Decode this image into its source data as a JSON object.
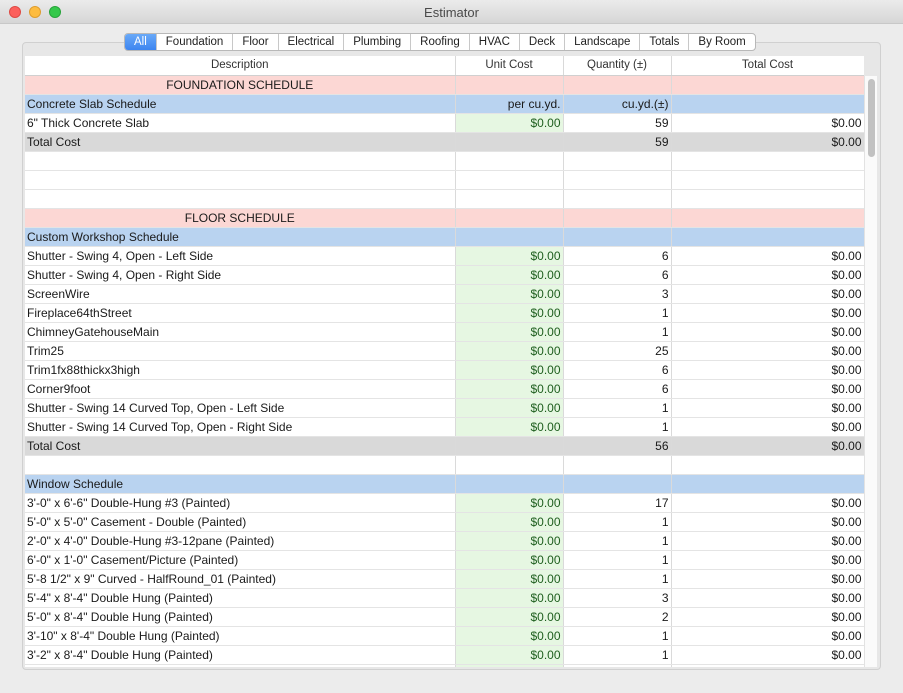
{
  "window": {
    "title": "Estimator"
  },
  "tabs": [
    {
      "label": "All",
      "active": true
    },
    {
      "label": "Foundation",
      "active": false
    },
    {
      "label": "Floor",
      "active": false
    },
    {
      "label": "Electrical",
      "active": false
    },
    {
      "label": "Plumbing",
      "active": false
    },
    {
      "label": "Roofing",
      "active": false
    },
    {
      "label": "HVAC",
      "active": false
    },
    {
      "label": "Deck",
      "active": false
    },
    {
      "label": "Landscape",
      "active": false
    },
    {
      "label": "Totals",
      "active": false
    },
    {
      "label": "By Room",
      "active": false
    }
  ],
  "columns": [
    "Description",
    "Unit Cost",
    "Quantity (±)",
    "Total Cost"
  ],
  "rows": [
    {
      "type": "sched",
      "desc": "FOUNDATION SCHEDULE",
      "unit": "",
      "qty": "",
      "total": ""
    },
    {
      "type": "sub",
      "desc": "Concrete Slab Schedule",
      "unit": "per cu.yd.",
      "qty": "cu.yd.(±)",
      "total": ""
    },
    {
      "type": "item",
      "desc": "6\" Thick Concrete Slab",
      "unit": "$0.00",
      "qty": "59",
      "total": "$0.00"
    },
    {
      "type": "total",
      "desc": "Total Cost",
      "unit": "",
      "qty": "59",
      "total": "$0.00"
    },
    {
      "type": "blank",
      "desc": "",
      "unit": "",
      "qty": "",
      "total": ""
    },
    {
      "type": "blank",
      "desc": "",
      "unit": "",
      "qty": "",
      "total": ""
    },
    {
      "type": "blank",
      "desc": "",
      "unit": "",
      "qty": "",
      "total": ""
    },
    {
      "type": "sched",
      "desc": "FLOOR SCHEDULE",
      "unit": "",
      "qty": "",
      "total": ""
    },
    {
      "type": "sub",
      "desc": "Custom Workshop Schedule",
      "unit": "",
      "qty": "",
      "total": ""
    },
    {
      "type": "item",
      "desc": "Shutter - Swing 4, Open - Left Side",
      "unit": "$0.00",
      "qty": "6",
      "total": "$0.00"
    },
    {
      "type": "item",
      "desc": "Shutter - Swing 4, Open - Right Side",
      "unit": "$0.00",
      "qty": "6",
      "total": "$0.00"
    },
    {
      "type": "item",
      "desc": "ScreenWire",
      "unit": "$0.00",
      "qty": "3",
      "total": "$0.00"
    },
    {
      "type": "item",
      "desc": "Fireplace64thStreet",
      "unit": "$0.00",
      "qty": "1",
      "total": "$0.00"
    },
    {
      "type": "item",
      "desc": "ChimneyGatehouseMain",
      "unit": "$0.00",
      "qty": "1",
      "total": "$0.00"
    },
    {
      "type": "item",
      "desc": "Trim25",
      "unit": "$0.00",
      "qty": "25",
      "total": "$0.00"
    },
    {
      "type": "item",
      "desc": "Trim1fx88thickx3high",
      "unit": "$0.00",
      "qty": "6",
      "total": "$0.00"
    },
    {
      "type": "item",
      "desc": "Corner9foot",
      "unit": "$0.00",
      "qty": "6",
      "total": "$0.00"
    },
    {
      "type": "item",
      "desc": "Shutter - Swing 14 Curved Top, Open - Left Side",
      "unit": "$0.00",
      "qty": "1",
      "total": "$0.00"
    },
    {
      "type": "item",
      "desc": "Shutter - Swing 14 Curved Top, Open - Right Side",
      "unit": "$0.00",
      "qty": "1",
      "total": "$0.00"
    },
    {
      "type": "total",
      "desc": "Total Cost",
      "unit": "",
      "qty": "56",
      "total": "$0.00"
    },
    {
      "type": "blank",
      "desc": "",
      "unit": "",
      "qty": "",
      "total": ""
    },
    {
      "type": "sub",
      "desc": "Window Schedule",
      "unit": "",
      "qty": "",
      "total": ""
    },
    {
      "type": "item",
      "desc": "3'-0\" x 6'-6\" Double-Hung #3 (Painted)",
      "unit": "$0.00",
      "qty": "17",
      "total": "$0.00"
    },
    {
      "type": "item",
      "desc": "5'-0\" x 5'-0\" Casement - Double (Painted)",
      "unit": "$0.00",
      "qty": "1",
      "total": "$0.00"
    },
    {
      "type": "item",
      "desc": "2'-0\" x 4'-0\" Double-Hung #3-12pane (Painted)",
      "unit": "$0.00",
      "qty": "1",
      "total": "$0.00"
    },
    {
      "type": "item",
      "desc": "6'-0\" x 1'-0\" Casement/Picture (Painted)",
      "unit": "$0.00",
      "qty": "1",
      "total": "$0.00"
    },
    {
      "type": "item",
      "desc": "5'-8 1/2\" x 9\" Curved - HalfRound_01 (Painted)",
      "unit": "$0.00",
      "qty": "1",
      "total": "$0.00"
    },
    {
      "type": "item",
      "desc": "5'-4\" x 8'-4\" Double Hung (Painted)",
      "unit": "$0.00",
      "qty": "3",
      "total": "$0.00"
    },
    {
      "type": "item",
      "desc": "5'-0\" x 8'-4\" Double Hung (Painted)",
      "unit": "$0.00",
      "qty": "2",
      "total": "$0.00"
    },
    {
      "type": "item",
      "desc": "3'-10\" x 8'-4\" Double Hung (Painted)",
      "unit": "$0.00",
      "qty": "1",
      "total": "$0.00"
    },
    {
      "type": "item",
      "desc": "3'-2\" x 8'-4\" Double Hung (Painted)",
      "unit": "$0.00",
      "qty": "1",
      "total": "$0.00"
    },
    {
      "type": "item",
      "desc": "",
      "unit": "",
      "qty": "",
      "total": ""
    }
  ]
}
